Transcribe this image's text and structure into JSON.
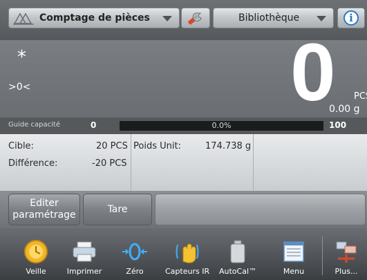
{
  "header": {
    "app_name": "Comptage de pièces",
    "library_label": "Bibliothèque",
    "info_glyph": "i"
  },
  "display": {
    "stable_indicator": "*",
    "zero_indicator": ">0<",
    "main_value": "0",
    "main_unit": "PCS",
    "sub_weight": "0.00 g"
  },
  "capacity": {
    "label": "Guide capacité",
    "min": "0",
    "percent": "0.0%",
    "fill_fraction": 0.0,
    "max": "100"
  },
  "fields": {
    "target_label": "Cible:",
    "target_value": "20 PCS",
    "difference_label": "Différence:",
    "difference_value": "-20 PCS",
    "apw_label": "Poids Unit:",
    "apw_value": "174.738 g"
  },
  "actions": {
    "edit_label_line1": "Editer",
    "edit_label_line2": "paramétrage",
    "tare_label": "Tare"
  },
  "nav": {
    "items": [
      {
        "label": "Veille",
        "icon": "standby-icon"
      },
      {
        "label": "Imprimer",
        "icon": "printer-icon"
      },
      {
        "label": "Zéro",
        "icon": "zero-icon"
      },
      {
        "label": "Capteurs IR",
        "icon": "ir-sensor-icon"
      },
      {
        "label": "AutoCal™",
        "icon": "autocal-weight-icon"
      },
      {
        "label": "Menu",
        "icon": "menu-icon"
      },
      {
        "label": "Plus...",
        "icon": "more-icon"
      }
    ]
  },
  "colors": {
    "accent_blue": "#2b78c2",
    "capacity_track": "#1a1c1e",
    "background": "#5f6366"
  }
}
